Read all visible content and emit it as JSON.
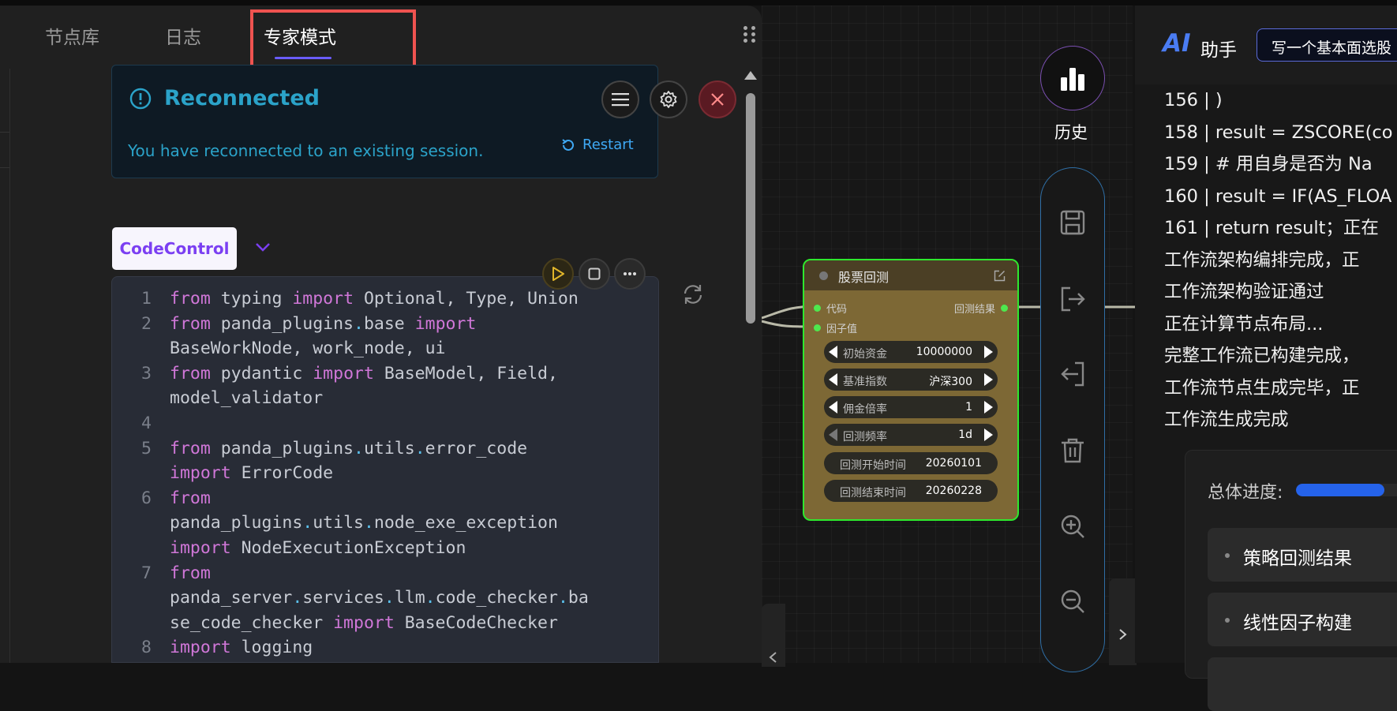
{
  "tabs": [
    {
      "label": "节点库"
    },
    {
      "label": "日志"
    },
    {
      "label": "专家模式"
    }
  ],
  "notification": {
    "title": "Reconnected",
    "message": "You have reconnected to an existing session.",
    "restart_label": "Restart"
  },
  "code_control": {
    "label": "CodeControl"
  },
  "code": {
    "lines": [
      {
        "n": "1",
        "t": "<span class=\"kw\">from</span> typing <span class=\"kw\">import</span> Optional, Type, Union"
      },
      {
        "n": "2",
        "t": "<span class=\"kw\">from</span> panda_plugins<span class=\"dt\">.</span>base <span class=\"kw\">import</span>"
      },
      {
        "n": "",
        "t": "BaseWorkNode, work_node, ui"
      },
      {
        "n": "3",
        "t": "<span class=\"kw\">from</span> pydantic <span class=\"kw\">import</span> BaseModel, Field,"
      },
      {
        "n": "",
        "t": "model_validator"
      },
      {
        "n": "4",
        "t": ""
      },
      {
        "n": "5",
        "t": "<span class=\"kw\">from</span> panda_plugins<span class=\"dt\">.</span>utils<span class=\"dt\">.</span>error_code"
      },
      {
        "n": "",
        "t": "<span class=\"kw\">import</span> ErrorCode"
      },
      {
        "n": "6",
        "t": "<span class=\"kw\">from</span>"
      },
      {
        "n": "",
        "t": "panda_plugins<span class=\"dt\">.</span>utils<span class=\"dt\">.</span>node_exe_exception"
      },
      {
        "n": "",
        "t": "<span class=\"kw\">import</span> NodeExecutionException"
      },
      {
        "n": "7",
        "t": "<span class=\"kw\">from</span>"
      },
      {
        "n": "",
        "t": "panda_server<span class=\"dt\">.</span>services<span class=\"dt\">.</span>llm<span class=\"dt\">.</span>code_checker<span class=\"dt\">.</span>ba"
      },
      {
        "n": "",
        "t": "se_code_checker <span class=\"kw\">import</span> BaseCodeChecker"
      },
      {
        "n": "8",
        "t": "<span class=\"kw\">import</span> logging"
      }
    ]
  },
  "node": {
    "title": "股票回测",
    "input_ports": [
      "代码",
      "因子值"
    ],
    "output_port": "回测结果",
    "fields": [
      {
        "label": "初始资金",
        "value": "10000000",
        "type": "stepper"
      },
      {
        "label": "基准指数",
        "value": "沪深300",
        "type": "stepper"
      },
      {
        "label": "佣金倍率",
        "value": "1",
        "type": "stepper"
      },
      {
        "label": "回测频率",
        "value": "1d",
        "type": "stepper"
      },
      {
        "label": "回测开始时间",
        "value": "20260101",
        "type": "readonly"
      },
      {
        "label": "回测结束时间",
        "value": "20260228",
        "type": "readonly"
      }
    ]
  },
  "history": {
    "label": "历史"
  },
  "sidebar_icons": [
    "save-icon",
    "export-icon",
    "import-icon",
    "trash-icon",
    "zoom-in-icon",
    "zoom-out-icon"
  ],
  "ai": {
    "logo": "AI",
    "title": "助手",
    "input_value": "写一个基本面选股",
    "log_lines": [
      "156 | )",
      "158 | result = ZSCORE(co",
      "159 | # 用自身是否为 Na",
      "160 | result = IF(AS_FLOA",
      "161 | return result；正在",
      "工作流架构编排完成，正",
      "工作流架构验证通过",
      "正在计算节点布局...",
      "完整工作流已构建完成，",
      "工作流节点生成完毕，正",
      "工作流生成完成"
    ],
    "progress_label": "总体进度:",
    "progress_fraction": 0.7,
    "tasks": [
      "策略回测结果",
      "线性因子构建"
    ]
  },
  "colors": {
    "accent": "#6a5cff",
    "node_border": "#2ee82e",
    "node_body": "#7d6835",
    "notification_text": "#2ba3c9",
    "highlight_box": "#ef5350"
  }
}
